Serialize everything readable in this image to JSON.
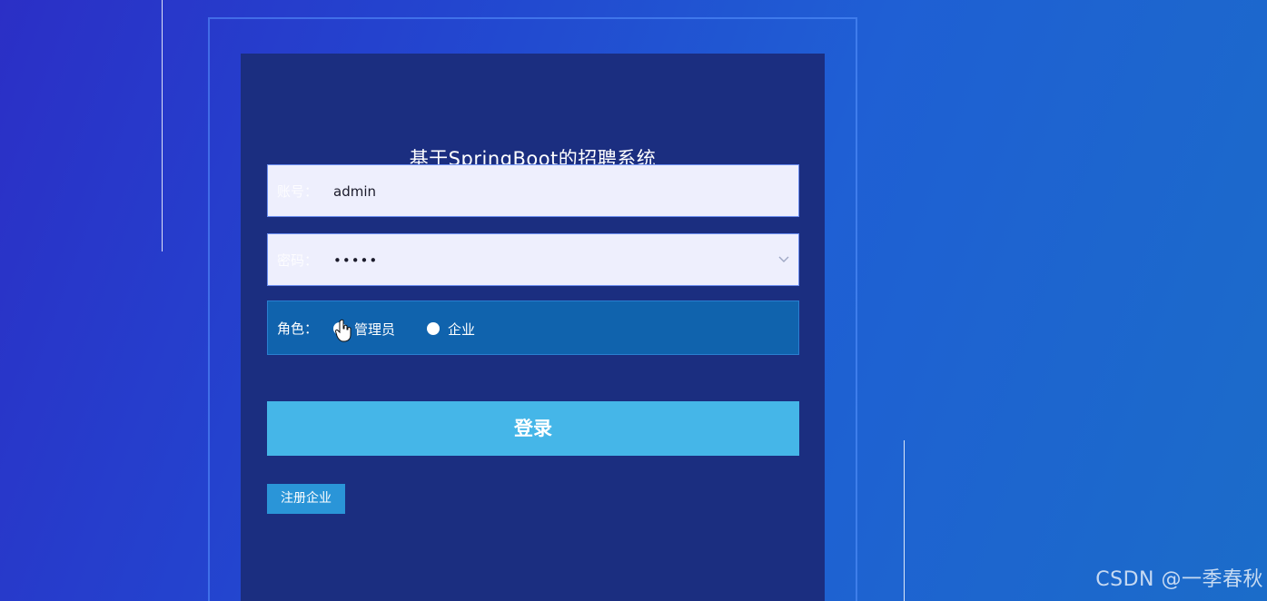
{
  "page": {
    "title": "基于SpringBoot的招聘系统"
  },
  "form": {
    "username": {
      "label": "账号：",
      "value": "admin"
    },
    "password": {
      "label": "密码：",
      "value": "•••••"
    },
    "role": {
      "label": "角色：",
      "options": [
        "管理员",
        "企业"
      ],
      "selected": "管理员"
    },
    "login_label": "登录",
    "register_label": "注册企业"
  },
  "watermark": "CSDN @一季春秋",
  "colors": {
    "panel": "#1b2e80",
    "login_button": "#45b6e8",
    "register_button": "#2a95d8",
    "role_row": "#1063ad",
    "input_bg": "#eeeffd"
  }
}
